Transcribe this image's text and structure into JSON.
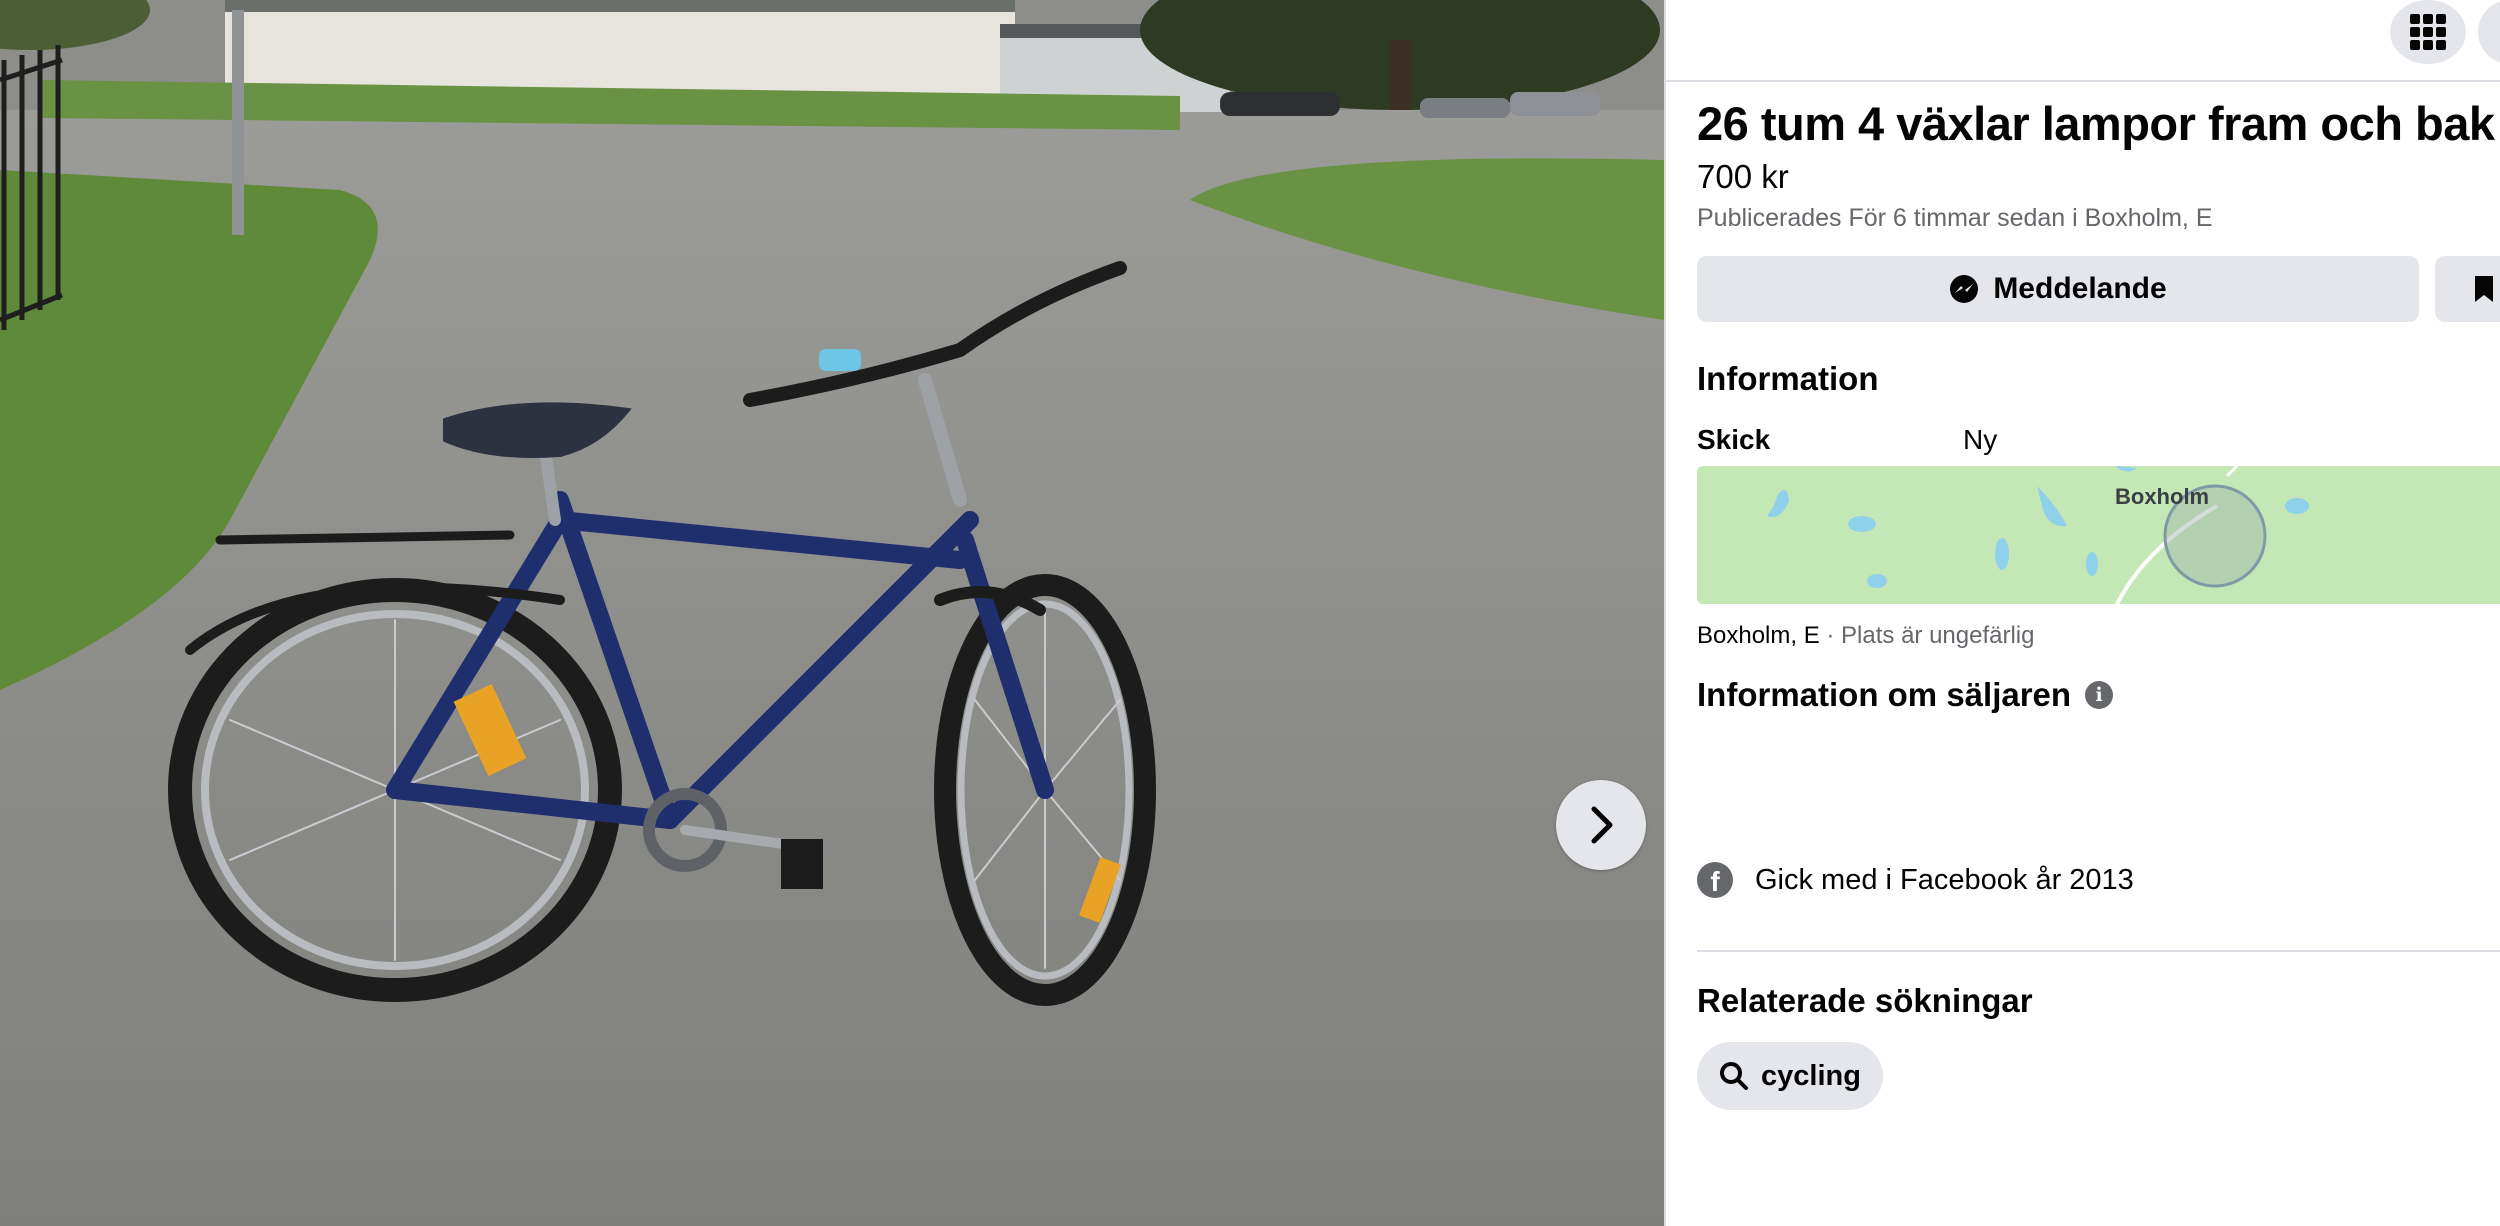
{
  "photo": {
    "next_icon": "chevron-right-icon"
  },
  "listing": {
    "title": "26 tum 4 växlar lampor fram och bak",
    "price": "700 kr",
    "published": "Publicerades För 6 timmar sedan i Boxholm, E",
    "message_button": "Meddelande",
    "message_icon": "messenger-icon",
    "save_icon": "bookmark-icon"
  },
  "topbar": {
    "menu_icon": "grid-menu-icon"
  },
  "info": {
    "heading": "Information",
    "condition_label": "Skick",
    "condition_value": "Ny"
  },
  "map": {
    "label": "Boxholm"
  },
  "location": {
    "place": "Boxholm, E",
    "separator": " · ",
    "note": "Plats är ungefärlig"
  },
  "seller": {
    "heading": "Information om säljaren",
    "info_icon_glyph": "i",
    "joined": "Gick med i Facebook år 2013",
    "fb_glyph": "f"
  },
  "related": {
    "heading": "Relaterade sökningar",
    "chip_label": "cycling"
  },
  "colors": {
    "panel_button": "#e4e6eb",
    "secondary_text": "#65676b",
    "map_green": "#c4e8b5"
  }
}
